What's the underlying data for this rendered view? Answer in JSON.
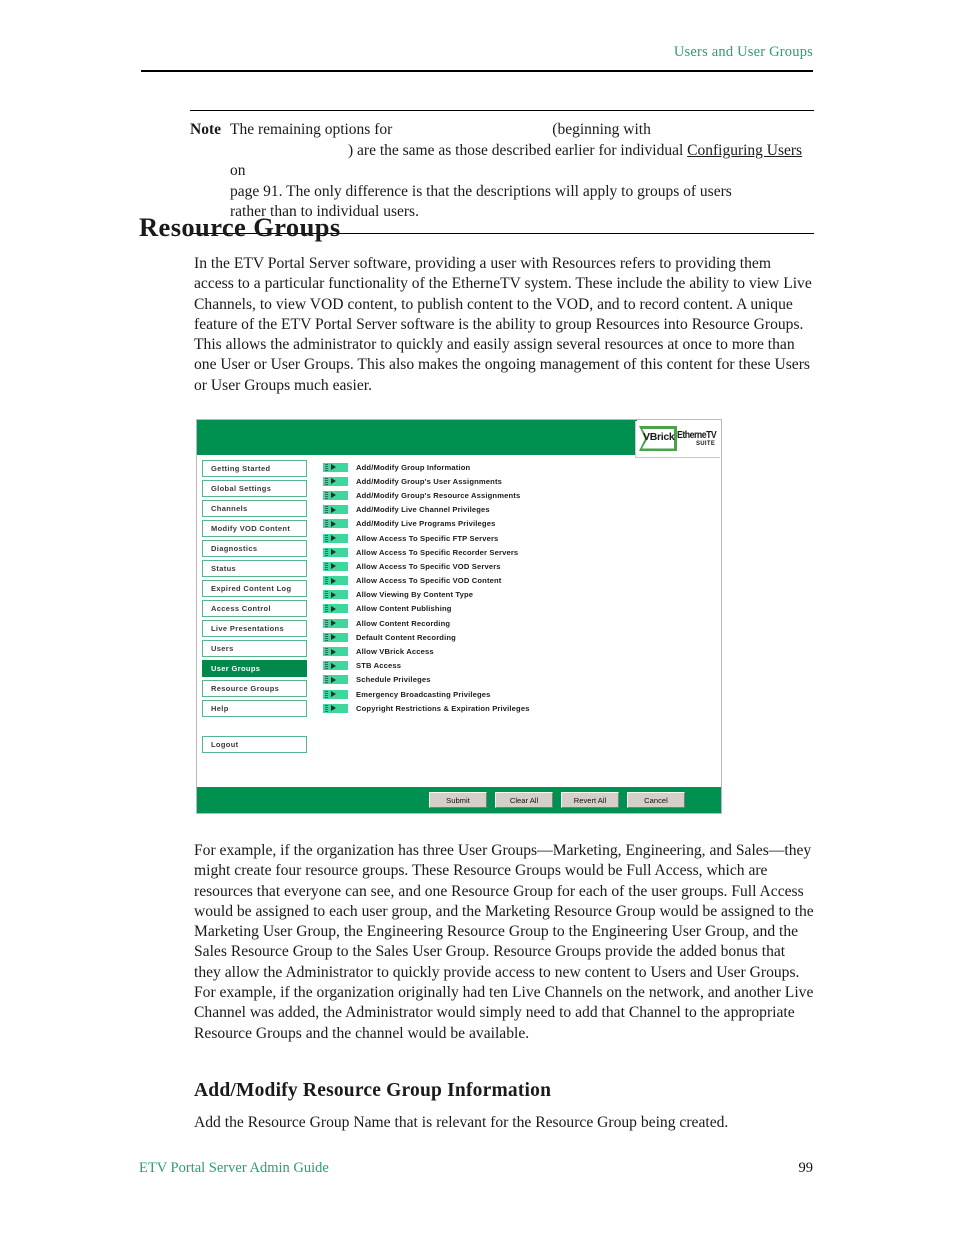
{
  "page": {
    "running_header": "Users and User Groups",
    "footer_left": "ETV Portal Server Admin Guide",
    "footer_page_number": "99",
    "accent_green": "#2e9e6b"
  },
  "note": {
    "label": "Note",
    "line1_a": "The remaining options for",
    "line1_b": "(beginning with",
    "line2_a": ") are the same as those described earlier for individual",
    "xref": "Configuring Users",
    "line2_b": "on",
    "line3": "page 91. The only difference is that the descriptions will apply to groups of users",
    "line4": "rather than to individual users."
  },
  "chapter_heading": "Resource Groups",
  "paragraphs": {
    "intro": "In the ETV Portal Server software, providing a user with Resources refers to providing them access to a particular functionality of the EtherneTV system. These include the ability to view Live Channels, to view VOD content, to publish content to the VOD, and to record content. A unique feature of the ETV Portal Server software is the ability to group Resources into Resource Groups. This allows the administrator to quickly and easily assign several resources at once to more than one User or User Groups. This also makes the ongoing management of this content for these Users or User Groups much easier.",
    "example": "For example, if the organization has three User Groups—Marketing, Engineering, and Sales—they might create four resource groups. These Resource Groups would be Full Access, which are resources that everyone can see, and one Resource Group for each of the user groups. Full Access would be assigned to each user group, and the Marketing Resource Group would be assigned to the Marketing User Group, the Engineering Resource Group to the Engineering User Group, and the Sales Resource Group to the Sales User Group. Resource Groups provide the added bonus that they allow the Administrator to quickly provide access to new content to Users and User Groups. For example, if the organization originally had ten Live Channels on the network, and another Live Channel was added, the Administrator would simply need to add that Channel to the appropriate Resource Groups and the channel would be available.",
    "addmod": "Add the Resource Group Name that is relevant for the Resource Group being created."
  },
  "section_heading": "Add/Modify Resource Group Information",
  "app": {
    "brand": {
      "vbrick": "VBrick",
      "product": "EtherneTV",
      "suite": "SUITE"
    },
    "colors": {
      "bar_green": "#009150",
      "selected_green": "#00894a",
      "bullet_green": "#3fd79d",
      "side_border": "#57b58c"
    },
    "sidebar": [
      {
        "label": "Getting Started",
        "selected": false
      },
      {
        "label": "Global Settings",
        "selected": false
      },
      {
        "label": "Channels",
        "selected": false
      },
      {
        "label": "Modify VOD Content",
        "selected": false
      },
      {
        "label": "Diagnostics",
        "selected": false
      },
      {
        "label": "Status",
        "selected": false
      },
      {
        "label": "Expired Content Log",
        "selected": false
      },
      {
        "label": "Access Control",
        "selected": false
      },
      {
        "label": "Live Presentations",
        "selected": false
      },
      {
        "label": "Users",
        "selected": false
      },
      {
        "label": "User Groups",
        "selected": true
      },
      {
        "label": "Resource Groups",
        "selected": false
      },
      {
        "label": "Help",
        "selected": false
      }
    ],
    "logout_label": "Logout",
    "privileges": [
      "Add/Modify Group Information",
      "Add/Modify Group's User Assignments",
      "Add/Modify Group's Resource Assignments",
      "Add/Modify Live Channel Privileges",
      "Add/Modify Live Programs Privileges",
      "Allow Access To Specific FTP Servers",
      "Allow Access To Specific Recorder Servers",
      "Allow Access To Specific VOD Servers",
      "Allow Access To Specific VOD Content",
      "Allow Viewing By Content Type",
      "Allow Content Publishing",
      "Allow Content Recording",
      "Default Content Recording",
      "Allow VBrick Access",
      "STB Access",
      "Schedule Privileges",
      "Emergency Broadcasting Privileges",
      "Copyright Restrictions & Expiration Privileges"
    ],
    "buttons": [
      "Submit",
      "Clear All",
      "Revert All",
      "Cancel"
    ]
  }
}
